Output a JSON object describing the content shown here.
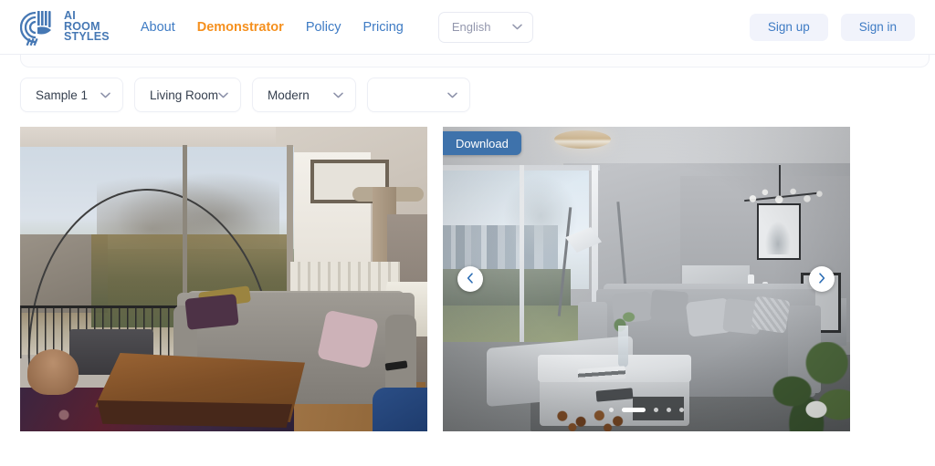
{
  "header": {
    "logo": {
      "icon": "ai-room-styles-logo-icon",
      "line1": "AI",
      "line2": "ROOM",
      "line3": "STYLES",
      "color": "#4678b4"
    },
    "nav": [
      {
        "label": "About",
        "active": false
      },
      {
        "label": "Demonstrator",
        "active": true
      },
      {
        "label": "Policy",
        "active": false
      },
      {
        "label": "Pricing",
        "active": false
      }
    ],
    "language_select": {
      "value": "English",
      "icon": "chevron-down-icon"
    },
    "actions": [
      {
        "label": "Sign up",
        "name": "sign-up-button"
      },
      {
        "label": "Sign in",
        "name": "sign-in-button"
      }
    ],
    "colors": {
      "nav_link": "#3e7bc4",
      "nav_active": "#f5901e",
      "auth_bg": "#f1f3fb"
    }
  },
  "filters": [
    {
      "name": "sample-select",
      "value": "Sample 1",
      "icon": "chevron-down-icon"
    },
    {
      "name": "room-type-select",
      "value": "Living Room",
      "icon": "chevron-down-icon"
    },
    {
      "name": "style-select",
      "value": "Modern",
      "icon": "chevron-down-icon"
    },
    {
      "name": "extra-select",
      "value": "",
      "icon": "chevron-down-icon"
    }
  ],
  "gallery": {
    "original": {
      "name": "original-room-image",
      "alt": "Original living room photo with grey fabric sofa, wooden coffee table, patterned rug, sliding glass door to balcony and cat tree"
    },
    "styled": {
      "name": "styled-room-image",
      "alt": "AI restyled modern living room in grey and white with city skyline view",
      "download_label": "Download",
      "download_color": "#3e72ab",
      "prev_icon": "chevron-left-icon",
      "next_icon": "chevron-right-icon",
      "dots": {
        "count": 5,
        "active_index": 1
      }
    }
  }
}
